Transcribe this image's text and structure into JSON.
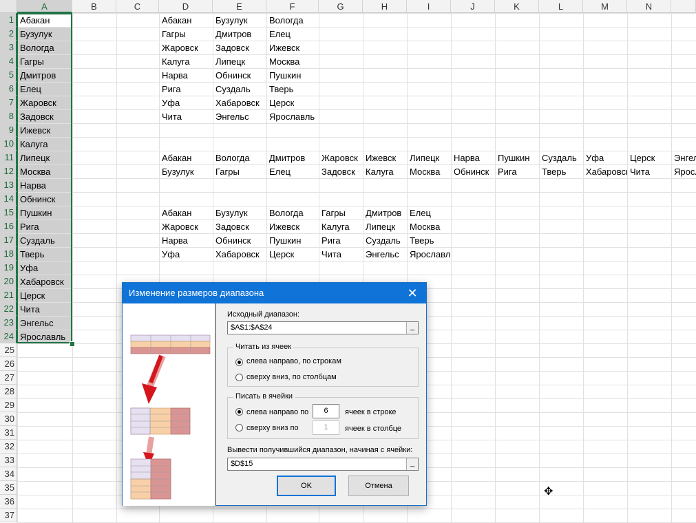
{
  "sheet": {
    "columns": [
      "A",
      "B",
      "C",
      "D",
      "E",
      "F",
      "G",
      "H",
      "I",
      "J",
      "K",
      "L",
      "M",
      "N"
    ],
    "rows": [
      "1",
      "2",
      "3",
      "4",
      "5",
      "6",
      "7",
      "8",
      "9",
      "10",
      "11",
      "12",
      "13",
      "14",
      "15",
      "16",
      "17",
      "18",
      "19",
      "20",
      "21",
      "22",
      "23",
      "24",
      "25",
      "26",
      "27",
      "28",
      "29",
      "30",
      "31",
      "32",
      "33",
      "34",
      "35",
      "36",
      "37"
    ],
    "col_a": [
      "Абакан",
      "Бузулук",
      "Вологда",
      "Гагры",
      "Дмитров",
      "Елец",
      "Жаровск",
      "Задовск",
      "Ижевск",
      "Калуга",
      "Липецк",
      "Москва",
      "Нарва",
      "Обнинск",
      "Пушкин",
      "Рига",
      "Суздаль",
      "Тверь",
      "Уфа",
      "Хабаровск",
      "Церск",
      "Чита",
      "Энгельс",
      "Ярославль"
    ],
    "block1": [
      [
        "Абакан",
        "Бузулук",
        "Вологда"
      ],
      [
        "Гагры",
        "Дмитров",
        "Елец"
      ],
      [
        "Жаровск",
        "Задовск",
        "Ижевск"
      ],
      [
        "Калуга",
        "Липецк",
        "Москва"
      ],
      [
        "Нарва",
        "Обнинск",
        "Пушкин"
      ],
      [
        "Рига",
        "Суздаль",
        "Тверь"
      ],
      [
        "Уфа",
        "Хабаровск",
        "Церск"
      ],
      [
        "Чита",
        "Энгельс",
        "Ярославль"
      ]
    ],
    "block2": [
      [
        "Абакан",
        "Вологда",
        "Дмитров",
        "Жаровск",
        "Ижевск",
        "Липецк",
        "Нарва",
        "Пушкин",
        "Суздаль",
        "Уфа",
        "Церск",
        "Энгельс"
      ],
      [
        "Бузулук",
        "Гагры",
        "Елец",
        "Задовск",
        "Калуга",
        "Москва",
        "Обнинск",
        "Рига",
        "Тверь",
        "Хабаровск",
        "Чита",
        "Ярославль"
      ]
    ],
    "block3": [
      [
        "Абакан",
        "Бузулук",
        "Вологда",
        "Гагры",
        "Дмитров",
        "Елец"
      ],
      [
        "Жаровск",
        "Задовск",
        "Ижевск",
        "Калуга",
        "Липецк",
        "Москва"
      ],
      [
        "Нарва",
        "Обнинск",
        "Пушкин",
        "Рига",
        "Суздаль",
        "Тверь"
      ],
      [
        "Уфа",
        "Хабаровск",
        "Церск",
        "Чита",
        "Энгельс",
        "Ярославль"
      ]
    ]
  },
  "dialog": {
    "title": "Изменение размеров диапазона",
    "close": "✕",
    "source_label": "Исходный диапазон:",
    "source_value": "$A$1:$A$24",
    "read_group": "Читать из ячеек",
    "read_rows": "слева направо, по строкам",
    "read_cols": "сверху вниз, по столбцам",
    "write_group": "Писать в ячейки",
    "write_rows": "слева направо по",
    "write_rows_value": "6",
    "write_rows_suffix": "ячеек в строке",
    "write_cols": "сверху вниз по",
    "write_cols_value": "1",
    "write_cols_suffix": "ячеек в столбце",
    "dest_label": "Вывести получившийся диапазон, начиная с ячейки:",
    "dest_value": "$D$15",
    "picker": "_",
    "ok": "OK",
    "cancel": "Отмена"
  },
  "colors": {
    "accent": "#217346",
    "title_bar": "#0f73d8",
    "arrow": "#d4161c",
    "purple": "#e6e0f0",
    "peach": "#f8d0a8",
    "red": "#d99594"
  }
}
